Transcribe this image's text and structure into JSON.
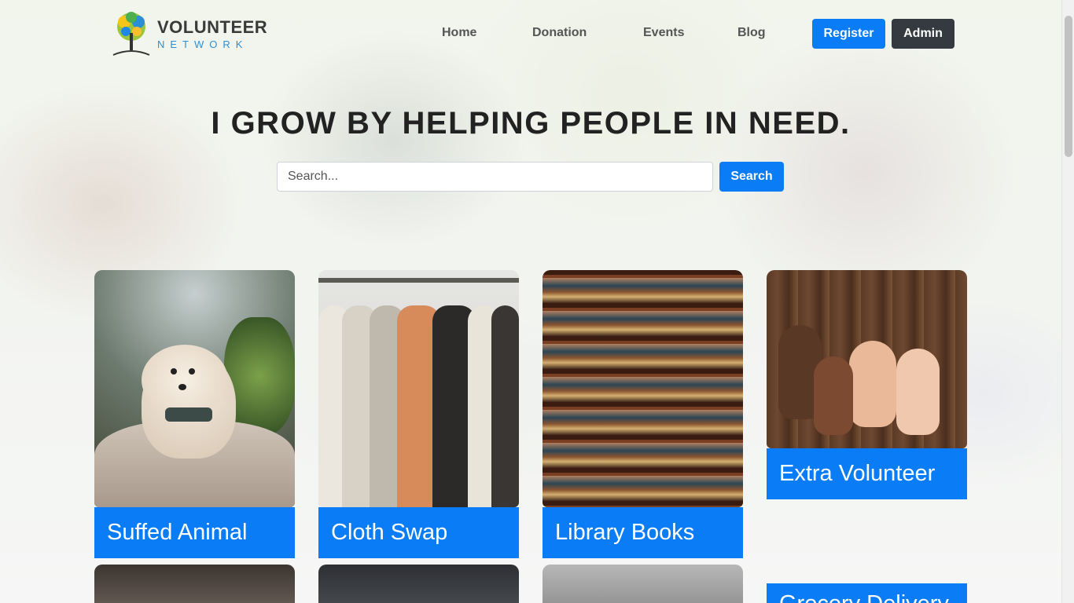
{
  "header": {
    "logo": {
      "title": "VOLUNTEER",
      "subtitle": "NETWORK",
      "icon": "tree-icon"
    },
    "nav": [
      {
        "label": "Home"
      },
      {
        "label": "Donation"
      },
      {
        "label": "Events"
      },
      {
        "label": "Blog"
      }
    ],
    "register_label": "Register",
    "admin_label": "Admin"
  },
  "hero": {
    "title": "I GROW BY HELPING PEOPLE IN NEED.",
    "search": {
      "placeholder": "Search...",
      "value": "",
      "button_label": "Search"
    }
  },
  "cards": [
    {
      "label": "Suffed Animal",
      "image": "dog-photo"
    },
    {
      "label": "Cloth Swap",
      "image": "clothes-rack-photo"
    },
    {
      "label": "Library Books",
      "image": "bookshelf-photo"
    },
    {
      "label": "Extra Volunteer",
      "image": "hands-photo"
    }
  ],
  "cards_row2": [
    {
      "image": "person-photo"
    },
    {
      "image": "laptop-photo"
    },
    {
      "image": "car-interior-photo"
    },
    {
      "label": "Grocery Delivery"
    }
  ],
  "colors": {
    "primary": "#0a7cf5",
    "dark": "#343a40",
    "logo_blue": "#2b8fd6"
  }
}
